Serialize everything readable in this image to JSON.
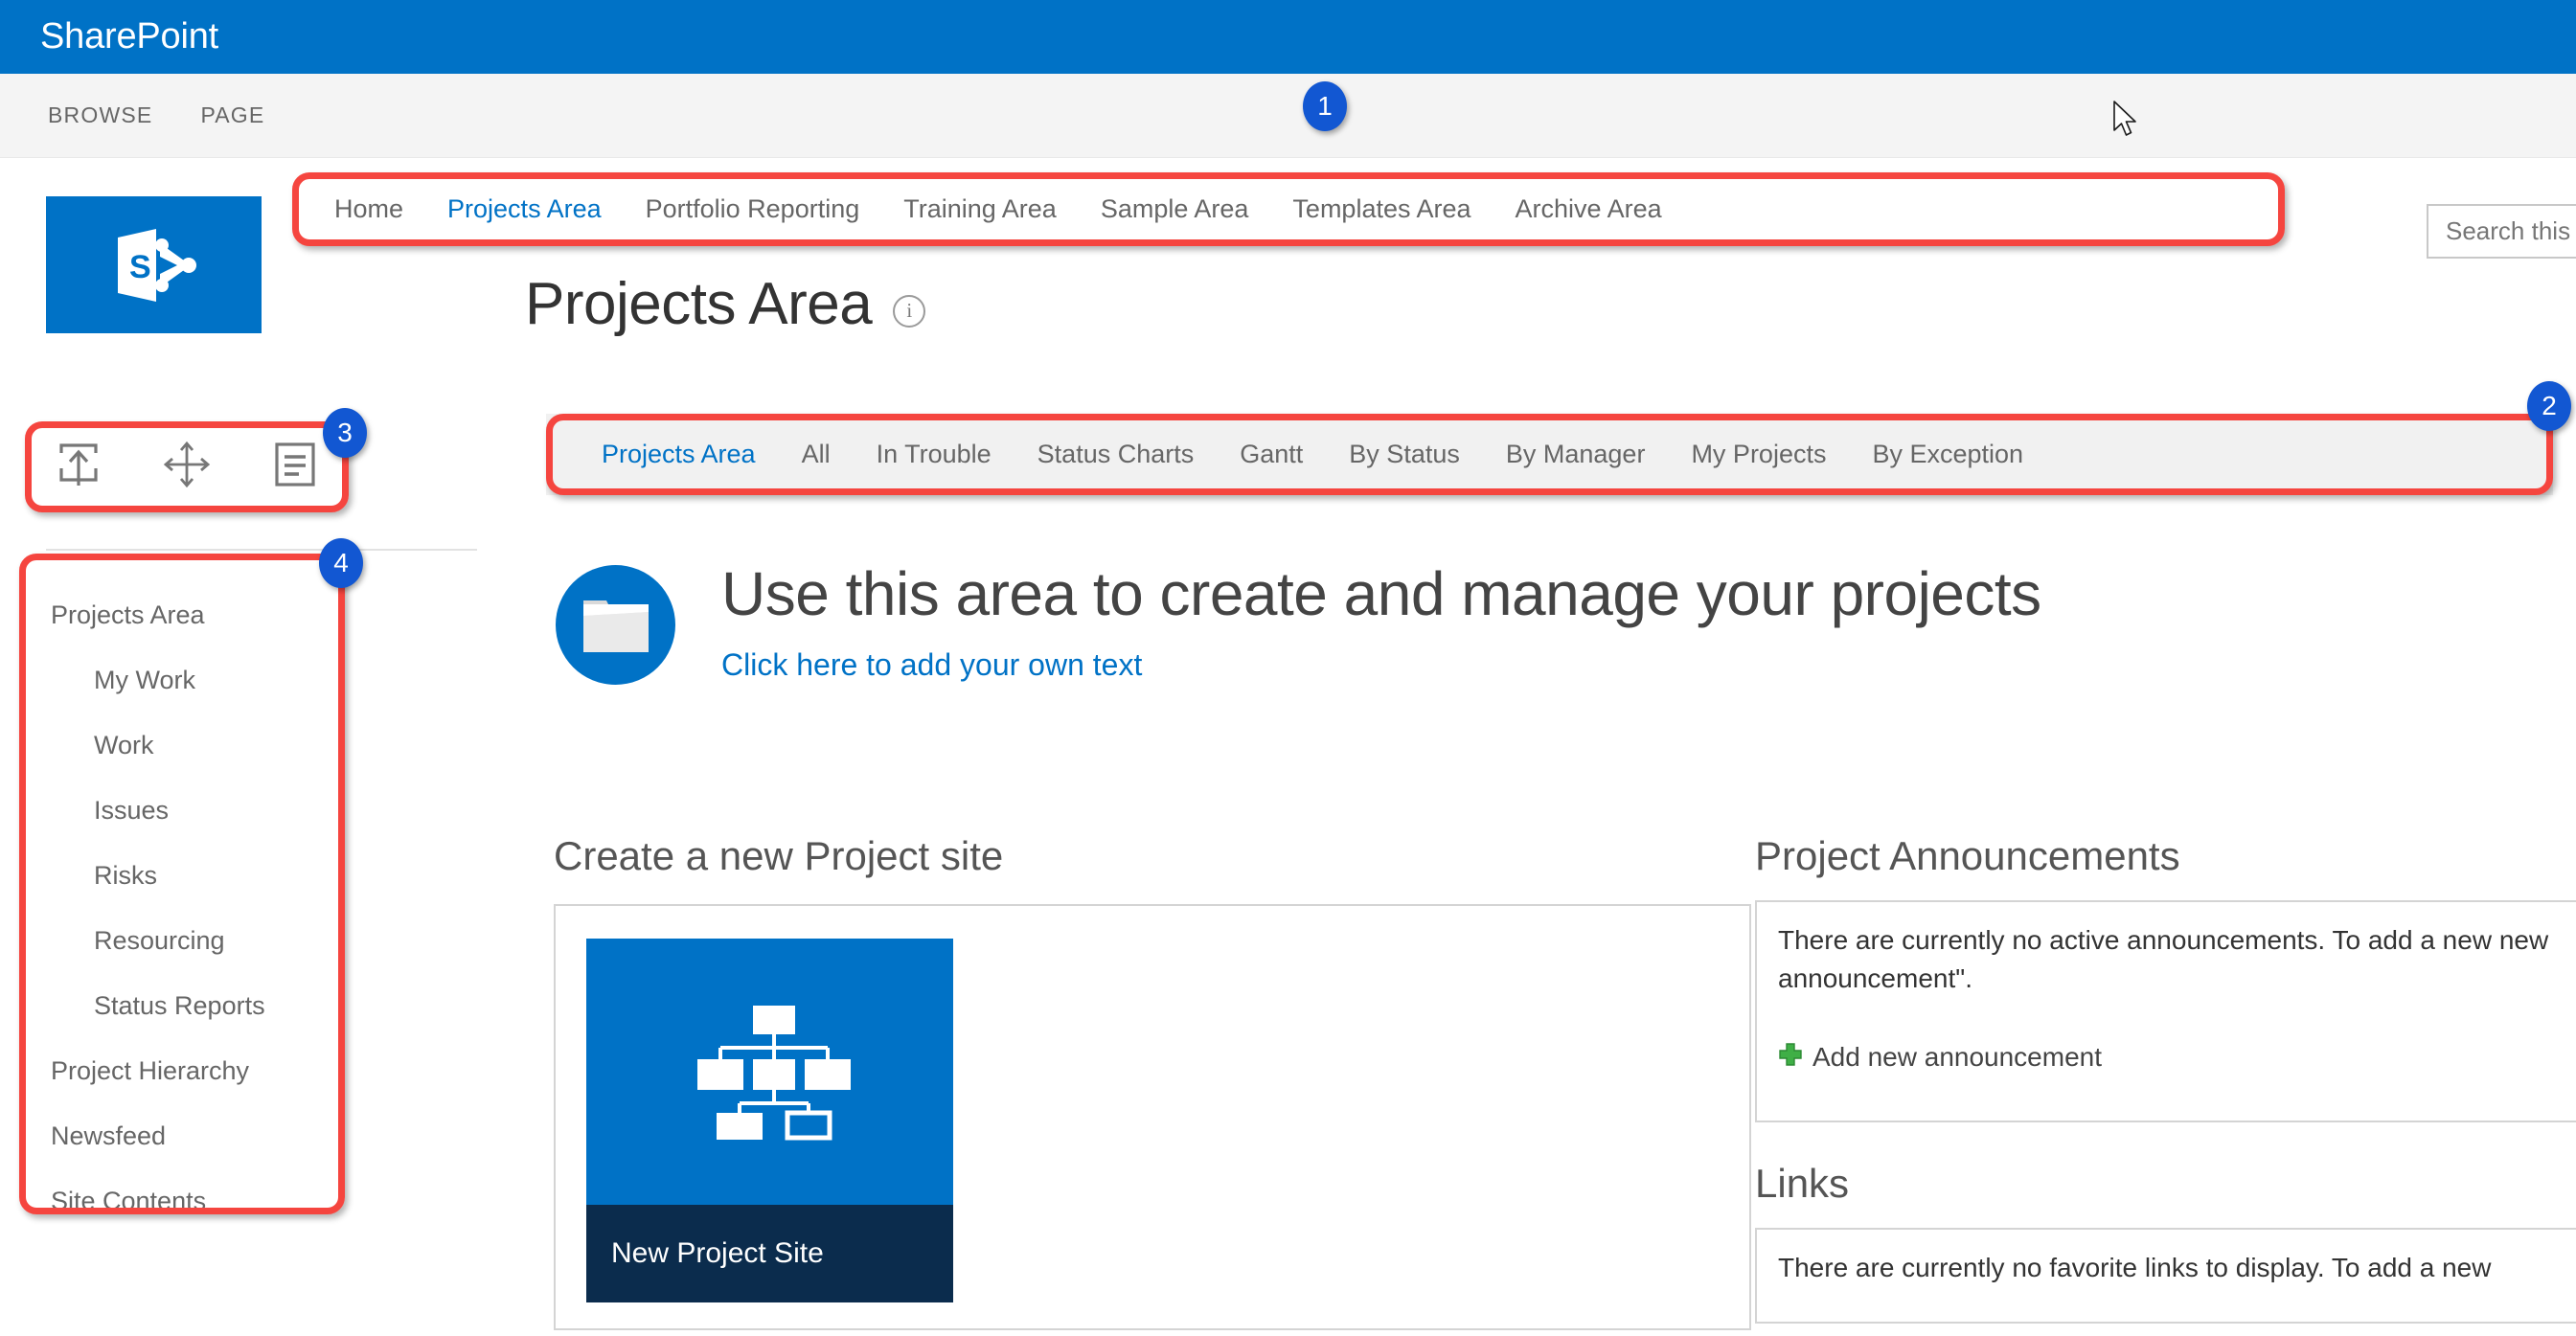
{
  "suite": {
    "title": "SharePoint"
  },
  "ribbon": {
    "tabs": [
      {
        "label": "BROWSE"
      },
      {
        "label": "PAGE"
      }
    ]
  },
  "search": {
    "placeholder": "Search this",
    "value": "Search this"
  },
  "topnav": {
    "items": [
      {
        "label": "Home",
        "active": false
      },
      {
        "label": "Projects Area",
        "active": true
      },
      {
        "label": "Portfolio Reporting",
        "active": false
      },
      {
        "label": "Training Area",
        "active": false
      },
      {
        "label": "Sample Area",
        "active": false
      },
      {
        "label": "Templates Area",
        "active": false
      },
      {
        "label": "Archive Area",
        "active": false
      }
    ]
  },
  "page": {
    "title": "Projects Area",
    "info_icon": "info-icon"
  },
  "sidebar_tools": {
    "items": [
      {
        "icon": "upload-icon",
        "name": "publish-button"
      },
      {
        "icon": "move-icon",
        "name": "move-button"
      },
      {
        "icon": "edit-list-icon",
        "name": "edit-list-button"
      }
    ]
  },
  "leftnav": {
    "items": [
      {
        "label": "Projects Area",
        "sub": false
      },
      {
        "label": "My Work",
        "sub": true
      },
      {
        "label": "Work",
        "sub": true
      },
      {
        "label": "Issues",
        "sub": true
      },
      {
        "label": "Risks",
        "sub": true
      },
      {
        "label": "Resourcing",
        "sub": true
      },
      {
        "label": "Status Reports",
        "sub": true
      },
      {
        "label": "Project Hierarchy",
        "sub": false
      },
      {
        "label": "Newsfeed",
        "sub": false
      },
      {
        "label": "Site Contents",
        "sub": false
      }
    ]
  },
  "subnav": {
    "items": [
      {
        "label": "Projects Area",
        "active": true
      },
      {
        "label": "All",
        "active": false
      },
      {
        "label": "In Trouble",
        "active": false
      },
      {
        "label": "Status Charts",
        "active": false
      },
      {
        "label": "Gantt",
        "active": false
      },
      {
        "label": "By Status",
        "active": false
      },
      {
        "label": "By Manager",
        "active": false
      },
      {
        "label": "My Projects",
        "active": false
      },
      {
        "label": "By Exception",
        "active": false
      }
    ]
  },
  "hero": {
    "icon": "folder-icon",
    "heading": "Use this area to create and manage your projects",
    "link": "Click here to add your own text"
  },
  "create_site": {
    "heading": "Create a new Project site",
    "tile_caption": "New Project Site",
    "tile_icon": "org-chart-icon"
  },
  "announcements": {
    "heading": "Project Announcements",
    "body": "There are currently no active announcements. To add a new new announcement\".",
    "add_label": "Add new announcement",
    "add_icon": "plus-icon"
  },
  "links": {
    "heading": "Links",
    "body": "There are currently no favorite links to display. To add a new"
  },
  "annotations": {
    "badges": [
      {
        "number": "1"
      },
      {
        "number": "2"
      },
      {
        "number": "3"
      },
      {
        "number": "4"
      }
    ],
    "accent_color": "#f5453f",
    "badge_color": "#1257d2"
  },
  "theme": {
    "brand_blue": "#0072c6",
    "tile_caption_navy": "#0b2c4d",
    "subnav_grey": "#f1f1f1",
    "text_grey": "#666666"
  }
}
